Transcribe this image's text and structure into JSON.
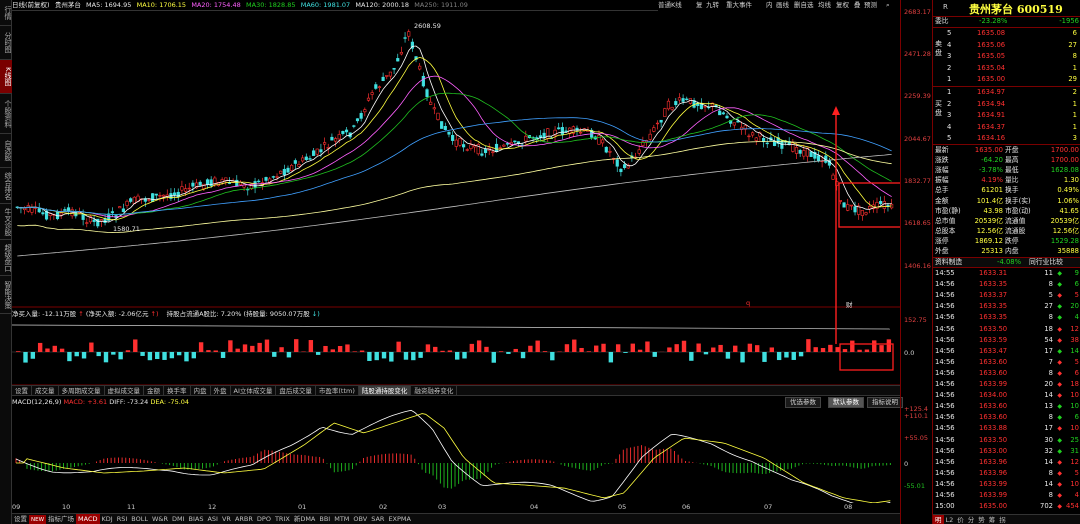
{
  "left_tabs": [
    "行情",
    "分时图",
    "K线图",
    "个股资料",
    "自选股",
    "综合排名",
    "牛叉诊股",
    "超级盘口",
    "智能决策"
  ],
  "top": {
    "period": "日线(前复权)",
    "stock_name": "贵州茅台",
    "ma5": "MA5: 1694.95",
    "ma10": "MA10: 1706.15",
    "ma20": "MA20: 1754.48",
    "ma30": "MA30: 1828.85",
    "ma60": "MA60: 1981.07",
    "ma120": "MA120: 2000.18",
    "ma250": "MA250: 1911.09",
    "buttons": [
      "普通K线",
      "复",
      "九转",
      "重大事件",
      "内",
      "画线",
      "删自选",
      "均线",
      "复权",
      "叠",
      "预测"
    ]
  },
  "price_axis": [
    "2683.17",
    "2471.28",
    "2259.39",
    "2044.67",
    "1832.77",
    "1618.65",
    "1406.16"
  ],
  "annotations": {
    "high": "2608.59",
    "low": "1580.71",
    "q_marker": "q",
    "cai_marker": "财"
  },
  "capital_bar": {
    "text1": "净买入量: -12.11万股",
    "text2": "(净买入额: -2.06亿元",
    "text3": "持股占流通A股比: 7.20%",
    "text4": "(持股量: 9050.07万股",
    "axis_top": "152.75",
    "axis_zero": "0.0"
  },
  "indicator_tabs": [
    "设置",
    "成交量",
    "多周期成交量",
    "虚拟成交量",
    "金额",
    "换手率",
    "内盘",
    "外盘",
    "AI立体成交量",
    "盘后成交量",
    "市盈率(ttm)",
    "陆股通持股变化",
    "融资融券变化"
  ],
  "macd": {
    "label": "MACD(12,26,9)",
    "macd": "MACD: +3.61",
    "diff": "DIFF: -73.24",
    "dea": "DEA: -75.04",
    "buttons": [
      "优选参数",
      "默认参数",
      "指标说明"
    ],
    "axis": [
      "+125.4",
      "+110.1",
      "+55.05",
      "0",
      "-55.01"
    ]
  },
  "months": [
    "09",
    "10",
    "11",
    "12",
    "01",
    "02",
    "03",
    "04",
    "05",
    "06",
    "07",
    "08"
  ],
  "bottom_tabs": [
    "设置",
    "NEW",
    "指标广场",
    "MACD",
    "KDJ",
    "RSI",
    "BOLL",
    "W&R",
    "DMI",
    "BIAS",
    "ASI",
    "VR",
    "ARBR",
    "DPO",
    "TRIX",
    "新DMA",
    "BBI",
    "MTM",
    "OBV",
    "SAR",
    "EXPMA"
  ],
  "quote": {
    "r": "R",
    "name": "贵州茅台 600519",
    "weibi_label": "委比",
    "weibi": "-23.28%",
    "weicha": "-1956",
    "sell_label": "卖盘",
    "buy_label": "买盘",
    "asks": [
      {
        "lvl": "5",
        "price": "1635.08",
        "vol": "6"
      },
      {
        "lvl": "4",
        "price": "1635.06",
        "vol": "27"
      },
      {
        "lvl": "3",
        "price": "1635.05",
        "vol": "8"
      },
      {
        "lvl": "2",
        "price": "1635.04",
        "vol": "1"
      },
      {
        "lvl": "1",
        "price": "1635.00",
        "vol": "29"
      }
    ],
    "bids": [
      {
        "lvl": "1",
        "price": "1634.97",
        "vol": "2"
      },
      {
        "lvl": "2",
        "price": "1634.94",
        "vol": "1"
      },
      {
        "lvl": "3",
        "price": "1634.91",
        "vol": "1"
      },
      {
        "lvl": "4",
        "price": "1634.37",
        "vol": "1"
      },
      {
        "lvl": "5",
        "price": "1634.16",
        "vol": "3"
      }
    ],
    "stats": [
      {
        "l1": "最新",
        "v1": "1635.00",
        "l2": "开盘",
        "v2": "1700.00"
      },
      {
        "l1": "涨跌",
        "v1": "-64.20",
        "l2": "最高",
        "v2": "1700.00"
      },
      {
        "l1": "涨幅",
        "v1": "-3.78%",
        "l2": "最低",
        "v2": "1628.08"
      },
      {
        "l1": "振幅",
        "v1": "4.19%",
        "l2": "量比",
        "v2": "1.30"
      },
      {
        "l1": "总手",
        "v1": "61201",
        "l2": "换手",
        "v2": "0.49%"
      },
      {
        "l1": "金额",
        "v1": "101.4亿",
        "l2": "换手(实)",
        "v2": "1.06%"
      },
      {
        "l1": "市盈(静)",
        "v1": "43.98",
        "l2": "市盈(动)",
        "v2": "41.65"
      },
      {
        "l1": "总市值",
        "v1": "20539亿",
        "l2": "流通值",
        "v2": "20539亿"
      },
      {
        "l1": "总股本",
        "v1": "12.56亿",
        "l2": "流通股",
        "v2": "12.56亿"
      },
      {
        "l1": "涨停",
        "v1": "1869.12",
        "l2": "跌停",
        "v2": "1529.28"
      },
      {
        "l1": "外盘",
        "v1": "25313",
        "l2": "内盘",
        "v2": "35888"
      }
    ],
    "section_tabs": [
      "资料制造",
      "-4.08%",
      "同行业比较"
    ],
    "ticks": [
      {
        "t": "14:55",
        "p": "1633.31",
        "v": "11",
        "d": "dn",
        "n": "9"
      },
      {
        "t": "14:56",
        "p": "1633.35",
        "v": "8",
        "d": "dn",
        "n": "6"
      },
      {
        "t": "14:56",
        "p": "1633.37",
        "v": "5",
        "d": "up",
        "n": "5"
      },
      {
        "t": "14:56",
        "p": "1633.35",
        "v": "27",
        "d": "dn",
        "n": "20"
      },
      {
        "t": "14:56",
        "p": "1633.35",
        "v": "8",
        "d": "dn",
        "n": "4"
      },
      {
        "t": "14:56",
        "p": "1633.50",
        "v": "18",
        "d": "up",
        "n": "12"
      },
      {
        "t": "14:56",
        "p": "1633.59",
        "v": "54",
        "d": "up",
        "n": "38"
      },
      {
        "t": "14:56",
        "p": "1633.47",
        "v": "17",
        "d": "dn",
        "n": "14"
      },
      {
        "t": "14:56",
        "p": "1633.60",
        "v": "7",
        "d": "up",
        "n": "5"
      },
      {
        "t": "14:56",
        "p": "1633.60",
        "v": "8",
        "d": "up",
        "n": "6"
      },
      {
        "t": "14:56",
        "p": "1633.99",
        "v": "20",
        "d": "up",
        "n": "18"
      },
      {
        "t": "14:56",
        "p": "1634.00",
        "v": "14",
        "d": "up",
        "n": "10"
      },
      {
        "t": "14:56",
        "p": "1633.60",
        "v": "13",
        "d": "dn",
        "n": "10"
      },
      {
        "t": "14:56",
        "p": "1633.60",
        "v": "8",
        "d": "dn",
        "n": "6"
      },
      {
        "t": "14:56",
        "p": "1633.88",
        "v": "17",
        "d": "up",
        "n": "10"
      },
      {
        "t": "14:56",
        "p": "1633.50",
        "v": "30",
        "d": "dn",
        "n": "25"
      },
      {
        "t": "14:56",
        "p": "1633.00",
        "v": "32",
        "d": "dn",
        "n": "31"
      },
      {
        "t": "14:56",
        "p": "1633.96",
        "v": "14",
        "d": "up",
        "n": "12"
      },
      {
        "t": "14:56",
        "p": "1633.96",
        "v": "8",
        "d": "up",
        "n": "5"
      },
      {
        "t": "14:56",
        "p": "1633.99",
        "v": "14",
        "d": "up",
        "n": "10"
      },
      {
        "t": "14:56",
        "p": "1633.99",
        "v": "8",
        "d": "up",
        "n": "4"
      },
      {
        "t": "15:00",
        "p": "1635.00",
        "v": "702",
        "d": "up",
        "n": "454"
      }
    ],
    "bottom_tabs": [
      "明",
      "L2",
      "价",
      "分",
      "势",
      "筹",
      "拐"
    ]
  }
}
